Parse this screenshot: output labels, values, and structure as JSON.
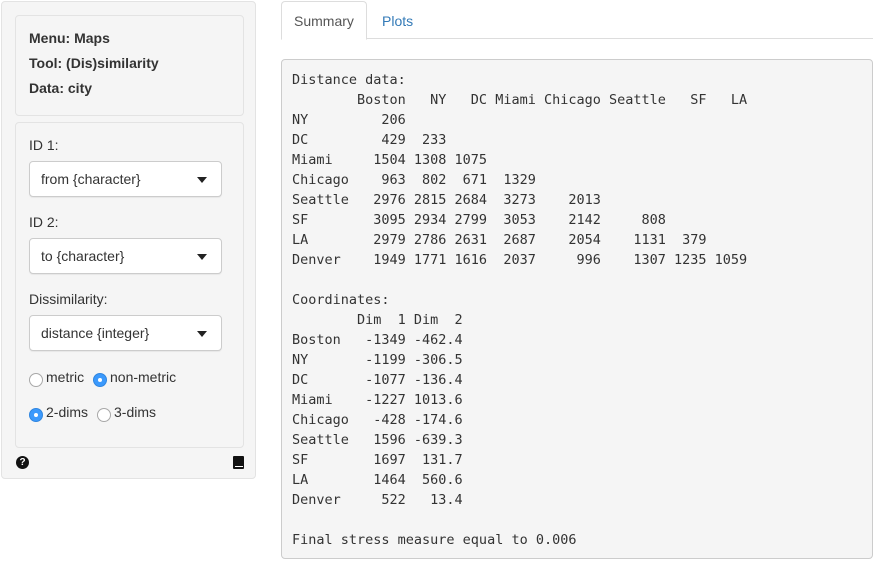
{
  "sidebar": {
    "info": {
      "menu": "Menu: Maps",
      "tool": "Tool: (Dis)similarity",
      "data": "Data: city"
    },
    "id1": {
      "label": "ID 1:",
      "value": "from {character}"
    },
    "id2": {
      "label": "ID 2:",
      "value": "to {character}"
    },
    "dissimilarity": {
      "label": "Dissimilarity:",
      "value": "distance {integer}"
    },
    "method": {
      "options": [
        "metric",
        "non-metric"
      ],
      "selected": "non-metric"
    },
    "dims": {
      "options": [
        "2-dims",
        "3-dims"
      ],
      "selected": "2-dims"
    },
    "help_icon": "question-circle-icon",
    "report_icon": "book-icon"
  },
  "tabs": [
    {
      "label": "Summary",
      "active": true
    },
    {
      "label": "Plots",
      "active": false
    }
  ],
  "summary": {
    "text": "Distance data:\n        Boston   NY   DC Miami Chicago Seattle   SF   LA\nNY         206                                         \nDC         429  233                                    \nMiami     1504 1308 1075                               \nChicago    963  802  671  1329                         \nSeattle   2976 2815 2684  3273    2013                 \nSF        3095 2934 2799  3053    2142     808         \nLA        2979 2786 2631  2687    2054    1131  379    \nDenver    1949 1771 1616  2037     996    1307 1235 1059\n\nCoordinates:\n        Dim  1 Dim  2\nBoston   -1349 -462.4\nNY       -1199 -306.5\nDC       -1077 -136.4\nMiami    -1227 1013.6\nChicago   -428 -174.6\nSeattle   1596 -639.3\nSF        1697  131.7\nLA        1464  560.6\nDenver     522   13.4\n\nFinal stress measure equal to 0.006"
  },
  "colors": {
    "accent": "#3b99fc",
    "link": "#337ab7",
    "well_bg": "#f5f5f5"
  }
}
